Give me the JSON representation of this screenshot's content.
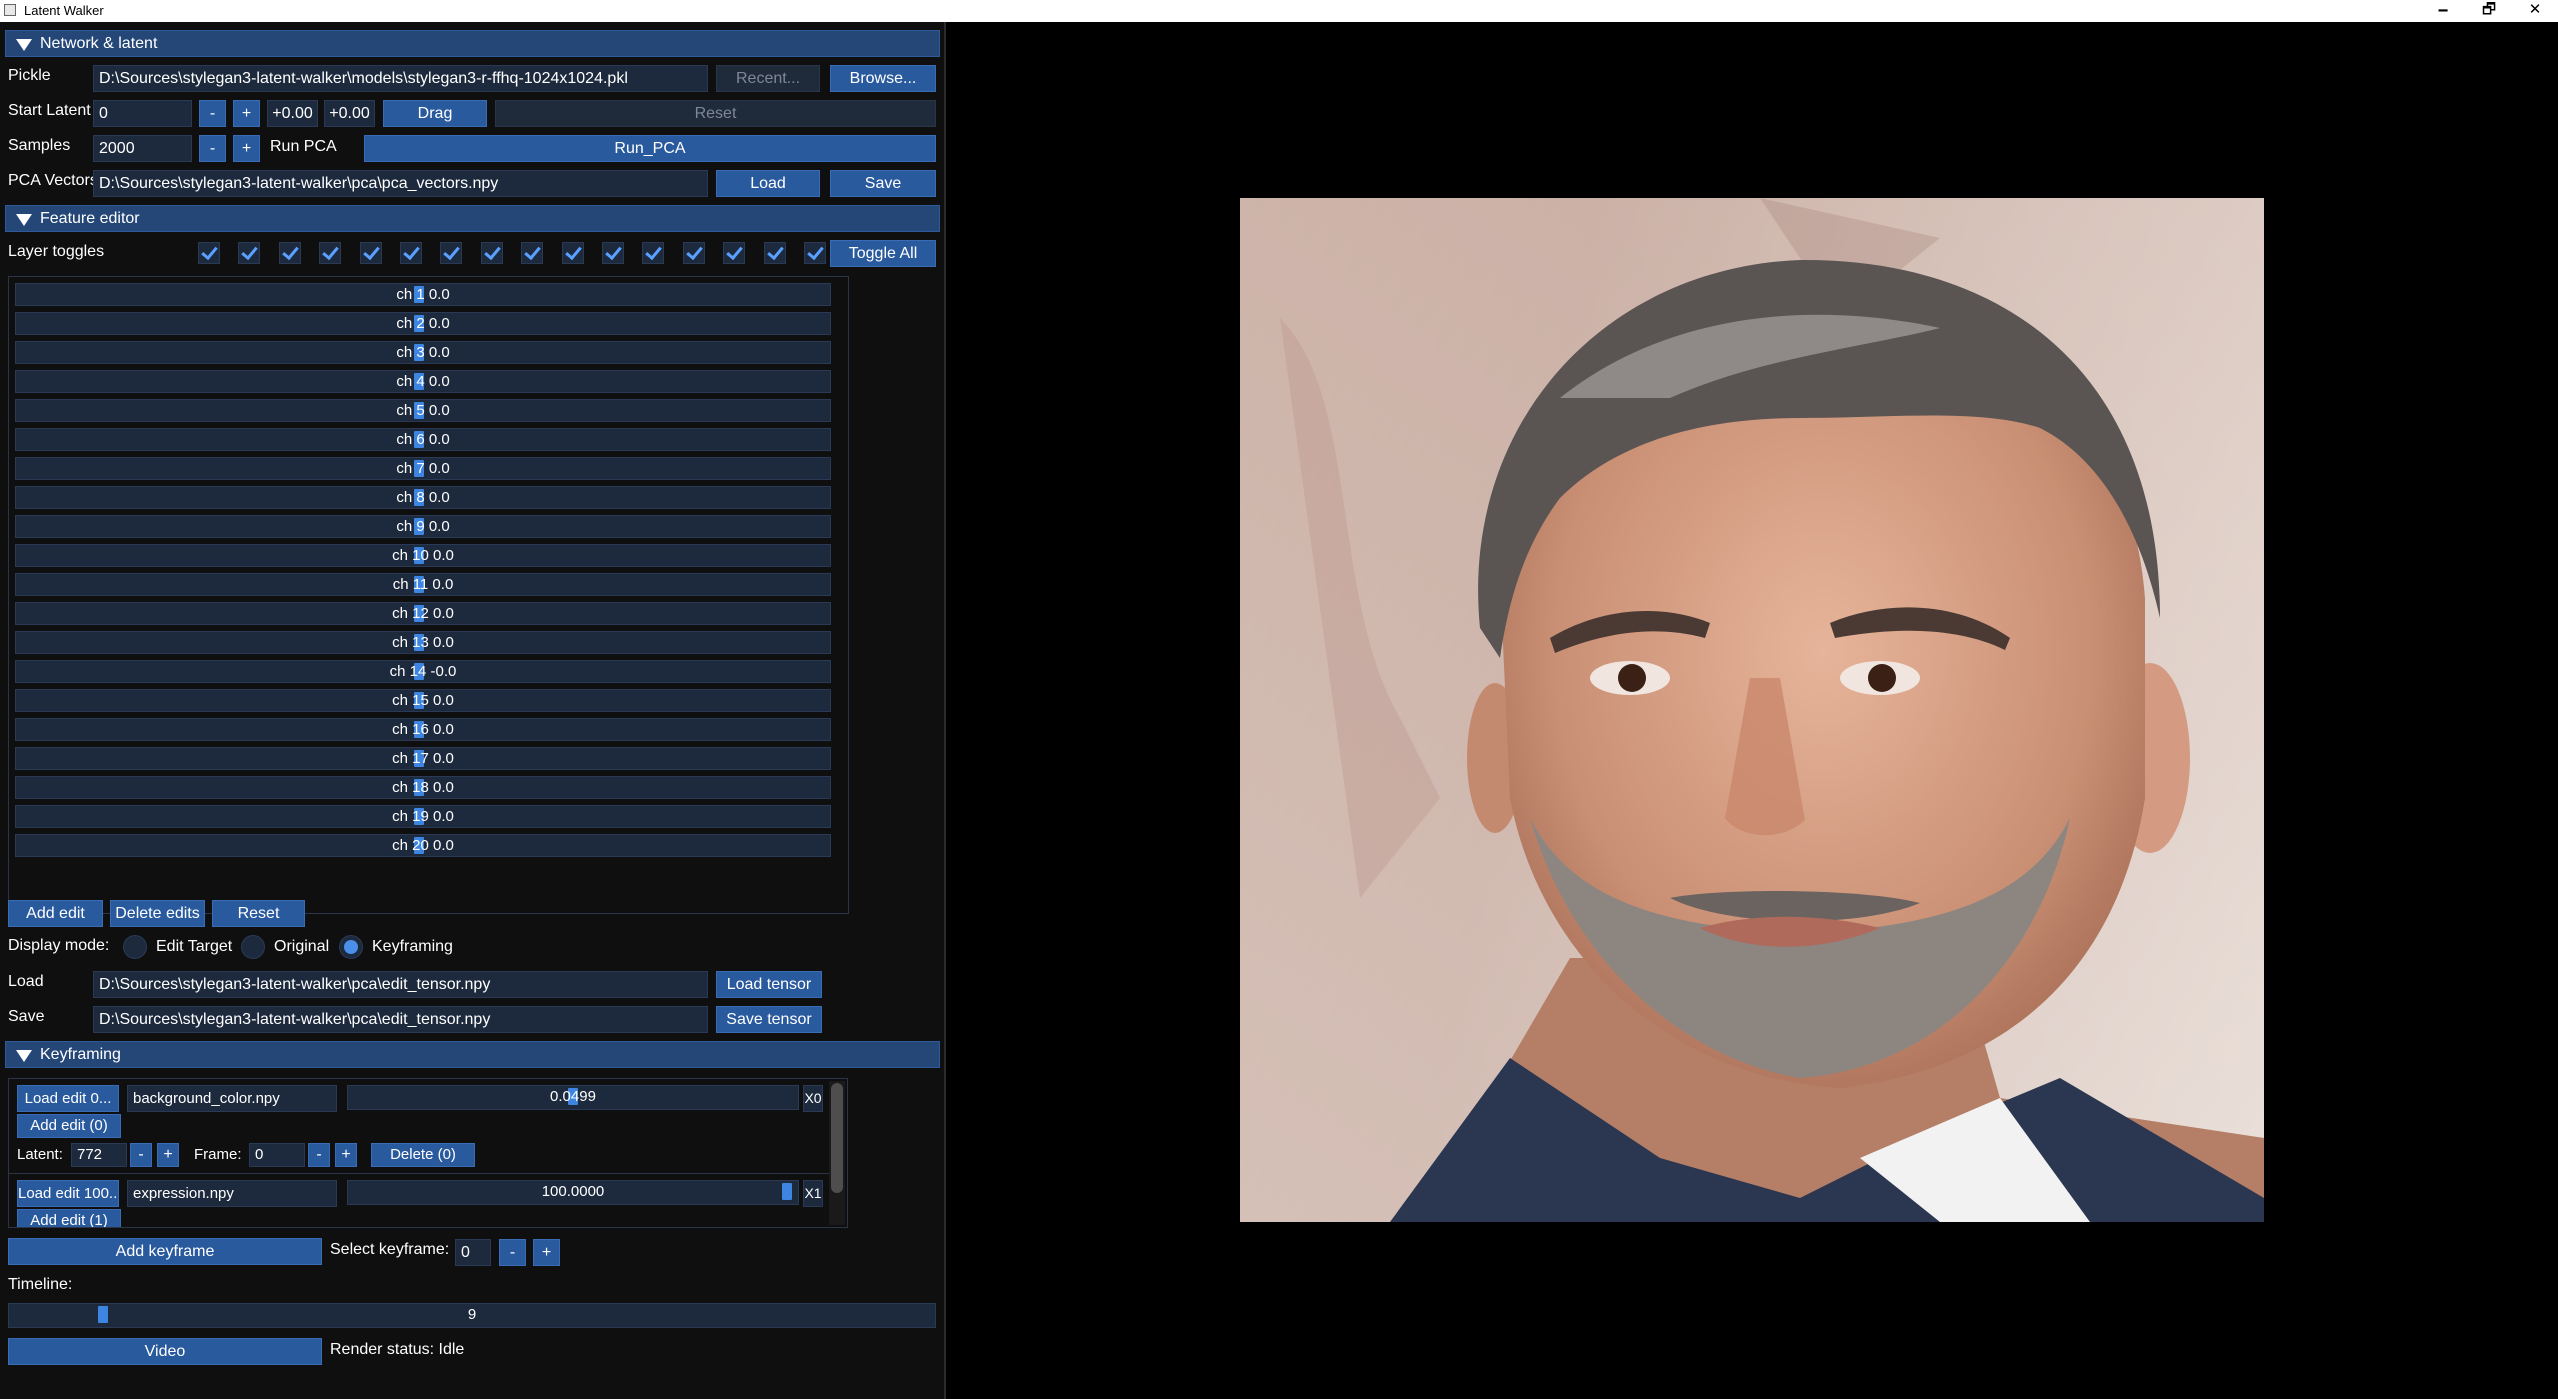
{
  "window": {
    "title": "Latent Walker",
    "minimize": "🗕",
    "restore": "🗗",
    "close": "✕"
  },
  "network": {
    "header": "Network & latent",
    "pickle_label": "Pickle",
    "pickle_path": "D:\\Sources\\stylegan3-latent-walker\\models\\stylegan3-r-ffhq-1024x1024.pkl",
    "recent": "Recent...",
    "browse": "Browse...",
    "start_latent_label": "Start Latent",
    "start_latent_value": "0",
    "minus": "-",
    "plus": "+",
    "offset_x": "+0.00",
    "offset_y": "+0.00",
    "drag": "Drag",
    "reset": "Reset",
    "samples_label": "Samples",
    "samples_value": "2000",
    "run_pca_label": "Run PCA",
    "run_pca_button": "Run_PCA",
    "pca_label": "PCA Vectors",
    "pca_path": "D:\\Sources\\stylegan3-latent-walker\\pca\\pca_vectors.npy",
    "load": "Load",
    "save": "Save"
  },
  "feature_editor": {
    "header": "Feature editor",
    "layer_toggles_label": "Layer toggles",
    "toggle_all": "Toggle All",
    "channels": [
      {
        "label": "ch 1 0.0",
        "value": 0.0
      },
      {
        "label": "ch 2 0.0",
        "value": 0.0
      },
      {
        "label": "ch 3 0.0",
        "value": 0.0
      },
      {
        "label": "ch 4 0.0",
        "value": 0.0
      },
      {
        "label": "ch 5 0.0",
        "value": 0.0
      },
      {
        "label": "ch 6 0.0",
        "value": 0.0
      },
      {
        "label": "ch 7 0.0",
        "value": 0.0
      },
      {
        "label": "ch 8 0.0",
        "value": 0.0
      },
      {
        "label": "ch 9 0.0",
        "value": 0.0
      },
      {
        "label": "ch 10 0.0",
        "value": 0.0
      },
      {
        "label": "ch 11 0.0",
        "value": 0.0
      },
      {
        "label": "ch 12 0.0",
        "value": 0.0
      },
      {
        "label": "ch 13 0.0",
        "value": 0.0
      },
      {
        "label": "ch 14 -0.0",
        "value": 0.0
      },
      {
        "label": "ch 15 0.0",
        "value": 0.0
      },
      {
        "label": "ch 16 0.0",
        "value": 0.0
      },
      {
        "label": "ch 17 0.0",
        "value": 0.0
      },
      {
        "label": "ch 18 0.0",
        "value": 0.0
      },
      {
        "label": "ch 19 0.0",
        "value": 0.0
      },
      {
        "label": "ch 20 0.0",
        "value": 0.0
      }
    ],
    "add_edit": "Add edit",
    "delete_edits": "Delete edits",
    "reset": "Reset",
    "display_mode_label": "Display mode:",
    "modes": [
      "Edit Target",
      "Original",
      "Keyframing"
    ],
    "selected_mode": "Keyframing",
    "load_label": "Load",
    "load_path": "D:\\Sources\\stylegan3-latent-walker\\pca\\edit_tensor.npy",
    "load_tensor": "Load tensor",
    "save_label": "Save",
    "save_path": "D:\\Sources\\stylegan3-latent-walker\\pca\\edit_tensor.npy",
    "save_tensor": "Save tensor"
  },
  "keyframing": {
    "header": "Keyframing",
    "row1": {
      "load_edit": "Load edit 0...",
      "file": "background_color.npy",
      "value": "0.0499",
      "value_fraction": 0.5,
      "suffix": "X0"
    },
    "add_edit_0": "Add edit (0)",
    "latent_label": "Latent:",
    "latent_value": "772",
    "frame_label": "Frame:",
    "frame_value": "0",
    "delete_0": "Delete (0)",
    "row2": {
      "load_edit": "Load edit 100...",
      "file": "expression.npy",
      "value": "100.0000",
      "value_fraction": 0.99,
      "suffix": "X1"
    },
    "add_edit_1": "Add edit (1)",
    "add_keyframe": "Add keyframe",
    "select_keyframe_label": "Select keyframe:",
    "select_keyframe_value": "0",
    "timeline_label": "Timeline:",
    "timeline_value": "9",
    "timeline_fraction": 0.095,
    "video": "Video",
    "render_status": "Render status: Idle"
  }
}
